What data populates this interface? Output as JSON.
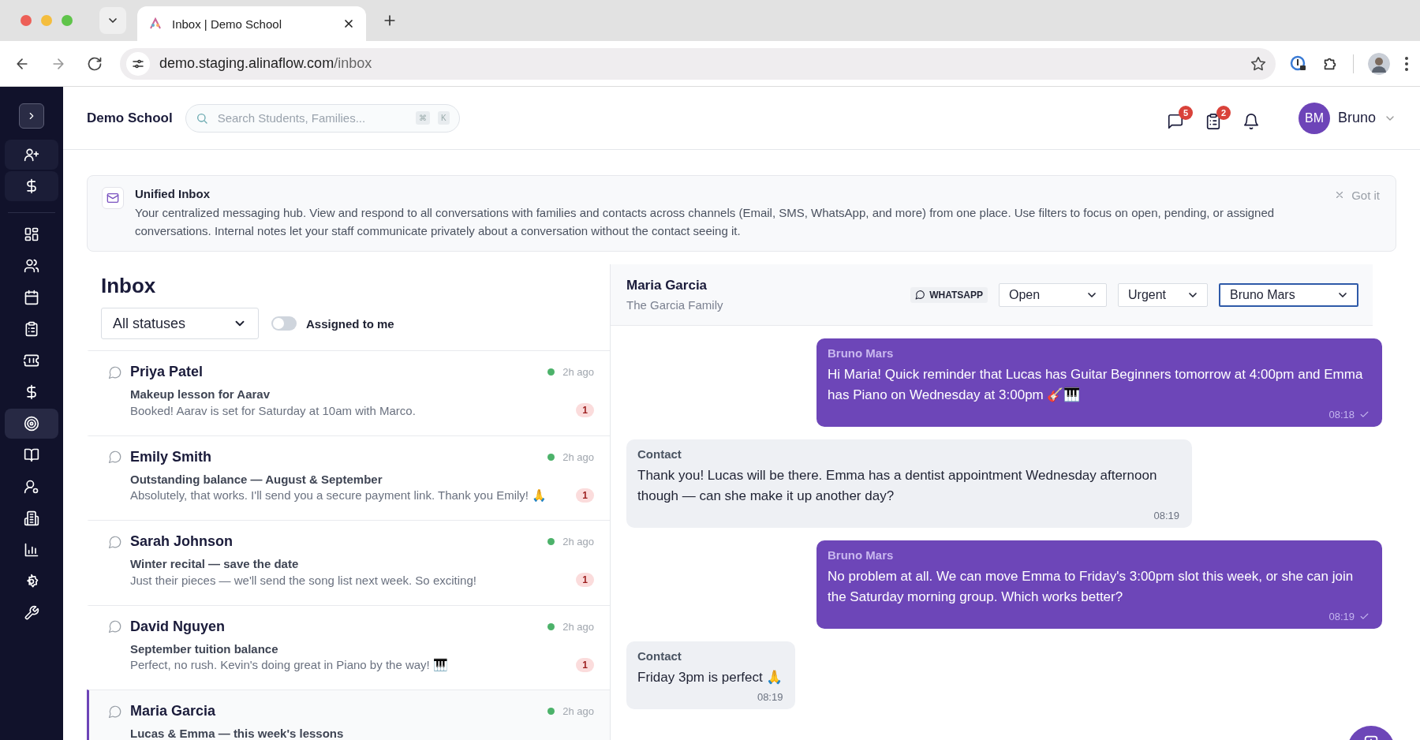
{
  "browser": {
    "tab_title": "Inbox | Demo School",
    "url_host": "demo.staging.alinaflow.com",
    "url_path": "/inbox"
  },
  "sidebar": {
    "quick_actions": [
      {
        "kind": "add-user"
      },
      {
        "kind": "billing"
      }
    ],
    "items": [
      {
        "kind": "dashboard",
        "selected": false
      },
      {
        "kind": "people",
        "selected": false
      },
      {
        "kind": "calendar",
        "selected": false
      },
      {
        "kind": "tasks",
        "selected": false
      },
      {
        "kind": "tickets",
        "selected": false
      },
      {
        "kind": "billing",
        "selected": false
      },
      {
        "kind": "goals",
        "selected": true
      },
      {
        "kind": "library",
        "selected": false
      },
      {
        "kind": "staff",
        "selected": false
      },
      {
        "kind": "locations",
        "selected": false
      },
      {
        "kind": "reports",
        "selected": false
      },
      {
        "kind": "settings",
        "selected": false
      },
      {
        "kind": "tools",
        "selected": false
      }
    ]
  },
  "header": {
    "school_name": "Demo School",
    "search": {
      "placeholder": "Search Students, Families...",
      "shortcut": [
        "⌘",
        "K"
      ]
    },
    "notifications": [
      {
        "kind": "messages",
        "count": "5"
      },
      {
        "kind": "tasks",
        "count": "2"
      },
      {
        "kind": "alerts"
      }
    ],
    "user": {
      "initials": "BM",
      "name": "Bruno"
    }
  },
  "banner": {
    "title": "Unified Inbox",
    "text": "Your centralized messaging hub. View and respond to all conversations with families and contacts across channels (Email, SMS, WhatsApp, and more) from one place. Use filters to focus on open, pending, or assigned conversations. Internal notes let your staff communicate privately about a conversation without the contact seeing it.",
    "dismiss": "Got it"
  },
  "inbox": {
    "title": "Inbox",
    "status_filter": "All statuses",
    "assigned_to_me": {
      "label": "Assigned to me",
      "on": false
    },
    "conversations": [
      {
        "name": "Priya Patel",
        "subject": "Makeup lesson for Aarav",
        "preview": "Booked! Aarav is set for Saturday at 10am with Marco.",
        "time": "2h ago",
        "unread": "1",
        "selected": false
      },
      {
        "name": "Emily Smith",
        "subject": "Outstanding balance — August & September",
        "preview": "Absolutely, that works. I'll send you a secure payment link. Thank you Emily! 🙏",
        "time": "2h ago",
        "unread": "1",
        "selected": false
      },
      {
        "name": "Sarah Johnson",
        "subject": "Winter recital — save the date",
        "preview": "Just their pieces — we'll send the song list next week. So exciting!",
        "time": "2h ago",
        "unread": "1",
        "selected": false
      },
      {
        "name": "David Nguyen",
        "subject": "September tuition balance",
        "preview": "Perfect, no rush. Kevin's doing great in Piano by the way! 🎹",
        "time": "2h ago",
        "unread": "1",
        "selected": false
      },
      {
        "name": "Maria Garcia",
        "subject": "Lucas & Emma — this week's lessons",
        "time": "2h ago",
        "selected": true
      }
    ]
  },
  "conversation": {
    "contact_name": "Maria Garcia",
    "family": "The Garcia Family",
    "channel": "WHATSAPP",
    "status": "Open",
    "priority": "Urgent",
    "assignee": "Bruno Mars",
    "messages": [
      {
        "kind": "outgoing",
        "sender": "Bruno Mars",
        "text": "Hi Maria! Quick reminder that Lucas has Guitar Beginners tomorrow at 4:00pm and Emma has Piano on Wednesday at 3:00pm 🎸🎹",
        "time": "08:18",
        "delivered": true
      },
      {
        "kind": "incoming",
        "sender": "Contact",
        "text": "Thank you! Lucas will be there. Emma has a dentist appointment Wednesday afternoon though — can she make it up another day?",
        "time": "08:19"
      },
      {
        "kind": "outgoing",
        "sender": "Bruno Mars",
        "text": "No problem at all. We can move Emma to Friday's 3:00pm slot this week, or she can join the Saturday morning group. Which works better?",
        "time": "08:19",
        "delivered": true
      },
      {
        "kind": "incoming",
        "sender": "Contact",
        "text": "Friday 3pm is perfect 🙏",
        "time": "08:19"
      }
    ]
  }
}
